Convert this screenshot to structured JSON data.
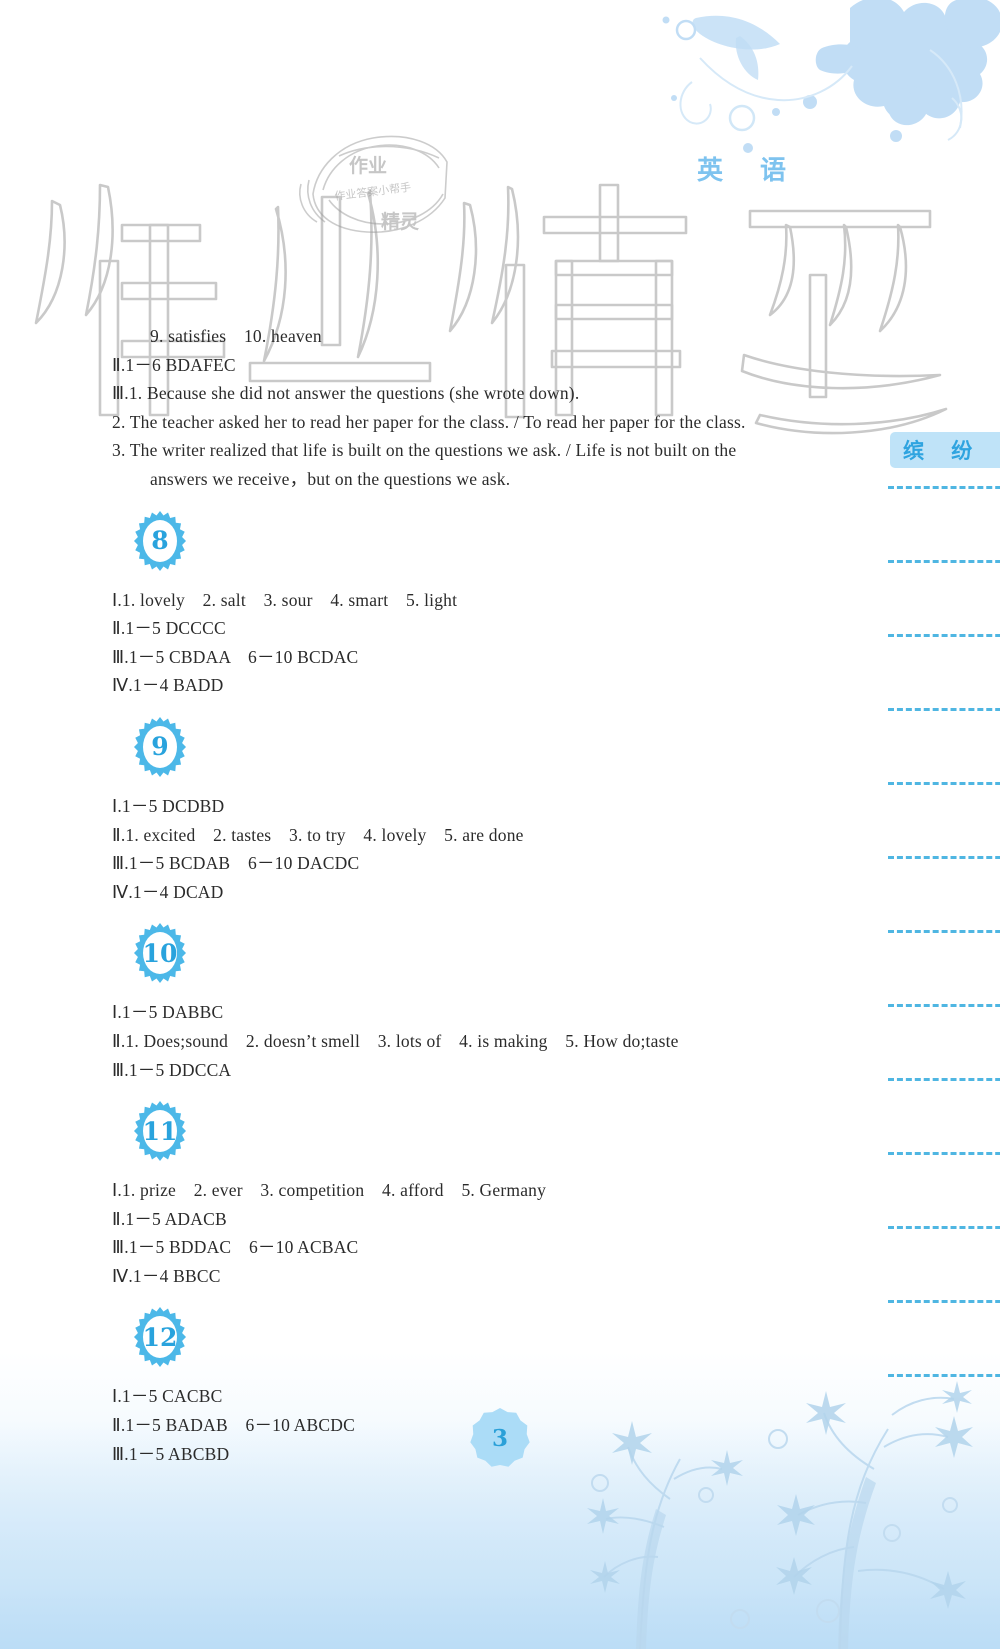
{
  "header": {
    "subject": "英 语",
    "watermark_big": "作业精灵",
    "stamp_top": "作业",
    "stamp_mid": "作业答案小帮手",
    "stamp_bottom": "精灵"
  },
  "side_panel": {
    "label": "缤 纷",
    "rule_count": 13
  },
  "intro_lines": [
    {
      "text": "9. satisfies　10. heaven",
      "style": "indent"
    },
    {
      "text": "Ⅱ.1－6 BDAFEC",
      "style": "hang"
    },
    {
      "text": "Ⅲ.1. Because she did not answer the questions (she wrote down).",
      "style": "hang"
    },
    {
      "text": "2. The teacher asked her to read her paper for the class. / To read her paper for the class.",
      "style": "hang"
    },
    {
      "text": "3. The writer realized that life is built on the questions we ask. / Life is not built on the",
      "style": "hang"
    },
    {
      "text": "answers we receive，but on the questions we ask.",
      "style": "indent"
    }
  ],
  "sections": [
    {
      "number": "8",
      "lines": [
        "Ⅰ.1. lovely　2. salt　3. sour　4. smart　5. light",
        "Ⅱ.1－5 DCCCC",
        "Ⅲ.1－5 CBDAA　6－10 BCDAC",
        "Ⅳ.1－4 BADD"
      ]
    },
    {
      "number": "9",
      "lines": [
        "Ⅰ.1－5 DCDBD",
        "Ⅱ.1. excited　2. tastes　3. to try　4. lovely　5. are done",
        "Ⅲ.1－5 BCDAB　6－10 DACDC",
        "Ⅳ.1－4 DCAD"
      ]
    },
    {
      "number": "10",
      "lines": [
        "Ⅰ.1－5 DABBC",
        "Ⅱ.1. Does;sound　2. doesn’t smell　3. lots of　4. is making　5. How do;taste",
        "Ⅲ.1－5 DDCCA"
      ]
    },
    {
      "number": "11",
      "lines": [
        "Ⅰ.1. prize　2. ever　3. competition　4. afford　5. Germany",
        "Ⅱ.1－5 ADACB",
        "Ⅲ.1－5 BDDAC　6－10 ACBAC",
        "Ⅳ.1－4 BBCC"
      ]
    },
    {
      "number": "12",
      "lines": [
        "Ⅰ.1－5 CACBC",
        "Ⅱ.1－5 BADAB　6－10 ABCDC",
        "Ⅲ.1－5 ABCBD"
      ]
    }
  ],
  "footer": {
    "page_number": "3"
  },
  "colors": {
    "accent": "#29a3dd",
    "badge_ring": "#4cb8e8",
    "side_label_bg": "#bfe3f8",
    "dashed_rule": "#4fb6e2",
    "text": "#2b2b2b",
    "decor_blue": "#bfdff5"
  }
}
